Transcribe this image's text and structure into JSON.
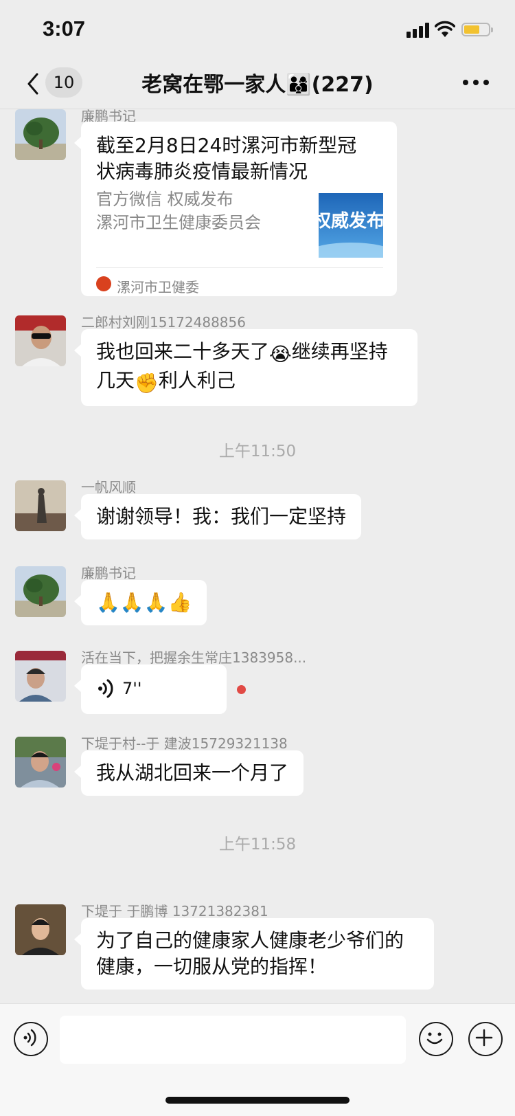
{
  "status_bar": {
    "time": "3:07"
  },
  "nav": {
    "unread_count": "10",
    "title": "老窝在鄂一家人👨‍👩‍👦(227)"
  },
  "messages": [
    {
      "sender": "廉鹏书记",
      "card": {
        "title": "截至2月8日24时漯河市新型冠状病毒肺炎疫情最新情况",
        "desc_line1": "官方微信  权威发布",
        "desc_line2": "漯河市卫生健康委员会",
        "thumb_text": "权威发布",
        "source": "漯河市卫健委"
      }
    },
    {
      "sender": "二郎村刘刚15172488856",
      "text_parts": [
        "我也回来二十多天了",
        "😭",
        "继续再坚持几天",
        "✊",
        "利人利己"
      ]
    },
    {
      "time_divider": "上午11:50"
    },
    {
      "sender": "一帆风顺",
      "text": "谢谢领导！我：我们一定坚持"
    },
    {
      "sender": "廉鹏书记",
      "emoji": "🙏🙏🙏👍"
    },
    {
      "sender": "活在当下，把握余生常庄1383958...",
      "voice_length": "7''"
    },
    {
      "sender": "下堤于村--于 建波15729321138",
      "text": "我从湖北回来一个月了"
    },
    {
      "time_divider": "上午11:58"
    },
    {
      "sender": "下堤于 于鹏博 13721382381",
      "text": "为了自己的健康家人健康老少爷们的健康，一切服从党的指挥！"
    }
  ],
  "colors": {
    "background": "#ededed",
    "bubble": "#ffffff",
    "unread_dot": "#e14a45",
    "battery": "#f2c230"
  },
  "icons": [
    "back-chevron-icon",
    "more-icon",
    "voice-icon",
    "emoji-icon",
    "plus-icon"
  ]
}
